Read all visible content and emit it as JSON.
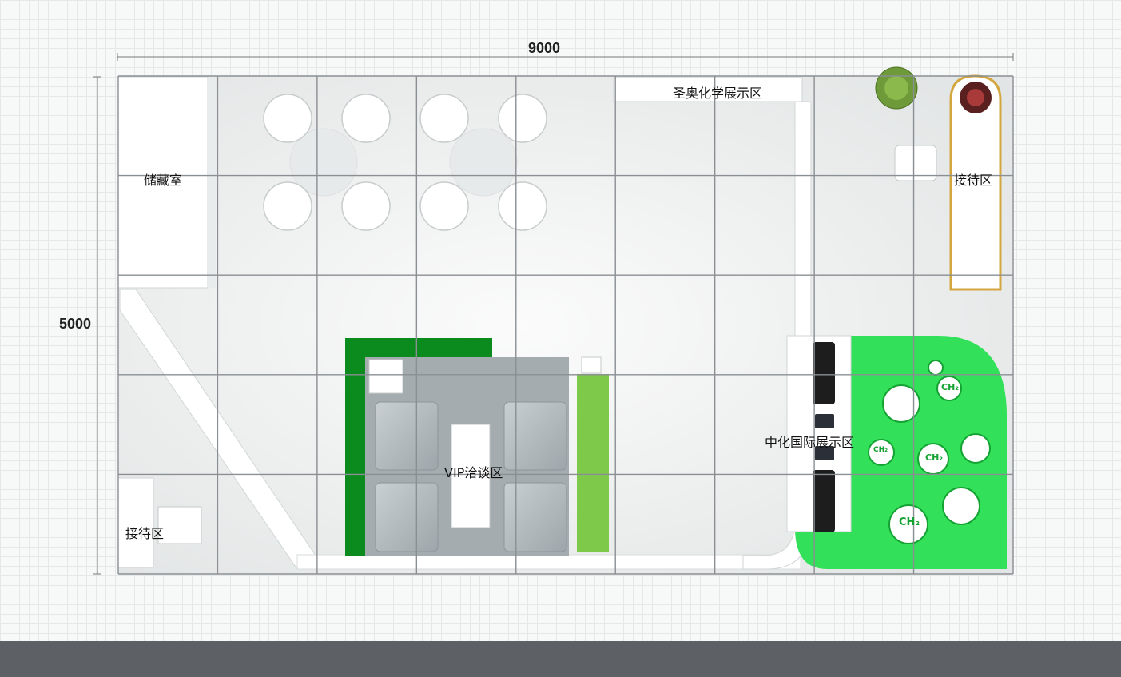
{
  "dimensions": {
    "width": "9000",
    "height": "5000"
  },
  "zones": {
    "storage": "储藏室",
    "shengao": "圣奥化学展示区",
    "reception_right": "接待区",
    "reception_left": "接待区",
    "vip": "VIP洽谈区",
    "zhonghua": "中化国际展示区"
  },
  "badges": [
    "CH₂",
    "CH₂",
    "CH₂",
    "CH₂"
  ],
  "colors": {
    "accent_green": "#33e05a",
    "dark_green": "#0b8a1e",
    "grid_line": "#8a8f93",
    "floor": "#eef0f0"
  }
}
